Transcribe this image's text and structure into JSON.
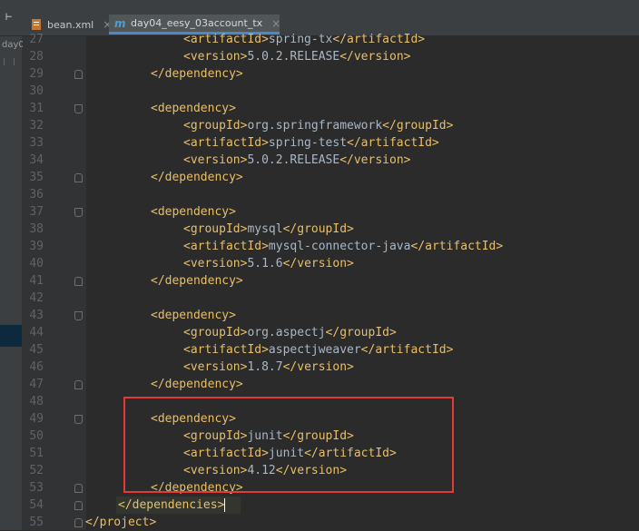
{
  "tabs": [
    {
      "label": "bean.xml",
      "icon": "xml-file-icon",
      "active": false
    },
    {
      "label": "day04_eesy_03account_tx",
      "icon": "maven-m-icon",
      "active": true
    }
  ],
  "sidebar": {
    "label": "day0"
  },
  "colors": {
    "tag": "#e8bf6a",
    "text": "#a9b7c6",
    "line_number": "#606366",
    "highlight_box": "#e53935"
  },
  "lines": [
    {
      "num": "27",
      "indent": 2,
      "open": "<artifactId>",
      "text": "spring-tx",
      "close": "</artifactId>"
    },
    {
      "num": "28",
      "indent": 2,
      "open": "<version>",
      "text": "5.0.2.RELEASE",
      "close": "</version>"
    },
    {
      "num": "29",
      "indent": 1,
      "open": "</dependency>",
      "text": "",
      "close": "",
      "fold": "close"
    },
    {
      "num": "30",
      "indent": 0,
      "open": "",
      "text": "",
      "close": ""
    },
    {
      "num": "31",
      "indent": 1,
      "open": "<dependency>",
      "text": "",
      "close": "",
      "fold": "open"
    },
    {
      "num": "32",
      "indent": 2,
      "open": "<groupId>",
      "text": "org.springframework",
      "close": "</groupId>"
    },
    {
      "num": "33",
      "indent": 2,
      "open": "<artifactId>",
      "text": "spring-test",
      "close": "</artifactId>"
    },
    {
      "num": "34",
      "indent": 2,
      "open": "<version>",
      "text": "5.0.2.RELEASE",
      "close": "</version>"
    },
    {
      "num": "35",
      "indent": 1,
      "open": "</dependency>",
      "text": "",
      "close": "",
      "fold": "close"
    },
    {
      "num": "36",
      "indent": 0,
      "open": "",
      "text": "",
      "close": ""
    },
    {
      "num": "37",
      "indent": 1,
      "open": "<dependency>",
      "text": "",
      "close": "",
      "fold": "open"
    },
    {
      "num": "38",
      "indent": 2,
      "open": "<groupId>",
      "text": "mysql",
      "close": "</groupId>"
    },
    {
      "num": "39",
      "indent": 2,
      "open": "<artifactId>",
      "text": "mysql-connector-java",
      "close": "</artifactId>"
    },
    {
      "num": "40",
      "indent": 2,
      "open": "<version>",
      "text": "5.1.6",
      "close": "</version>"
    },
    {
      "num": "41",
      "indent": 1,
      "open": "</dependency>",
      "text": "",
      "close": "",
      "fold": "close"
    },
    {
      "num": "42",
      "indent": 0,
      "open": "",
      "text": "",
      "close": ""
    },
    {
      "num": "43",
      "indent": 1,
      "open": "<dependency>",
      "text": "",
      "close": "",
      "fold": "open"
    },
    {
      "num": "44",
      "indent": 2,
      "open": "<groupId>",
      "text": "org.aspectj",
      "close": "</groupId>"
    },
    {
      "num": "45",
      "indent": 2,
      "open": "<artifactId>",
      "text": "aspectjweaver",
      "close": "</artifactId>"
    },
    {
      "num": "46",
      "indent": 2,
      "open": "<version>",
      "text": "1.8.7",
      "close": "</version>"
    },
    {
      "num": "47",
      "indent": 1,
      "open": "</dependency>",
      "text": "",
      "close": "",
      "fold": "close"
    },
    {
      "num": "48",
      "indent": 0,
      "open": "",
      "text": "",
      "close": ""
    },
    {
      "num": "49",
      "indent": 1,
      "open": "<dependency>",
      "text": "",
      "close": "",
      "fold": "open"
    },
    {
      "num": "50",
      "indent": 2,
      "open": "<groupId>",
      "text": "junit",
      "close": "</groupId>"
    },
    {
      "num": "51",
      "indent": 2,
      "open": "<artifactId>",
      "text": "junit",
      "close": "</artifactId>"
    },
    {
      "num": "52",
      "indent": 2,
      "open": "<version>",
      "text": "4.12",
      "close": "</version>"
    },
    {
      "num": "53",
      "indent": 1,
      "open": "</dependency>",
      "text": "",
      "close": "",
      "fold": "close"
    },
    {
      "num": "54",
      "indent": 0.5,
      "open": "</dependencies>",
      "text": "",
      "close": "",
      "fold": "close",
      "highlight": true
    },
    {
      "num": "55",
      "indent": 0,
      "open": "</project>",
      "text": "",
      "close": "",
      "fold": "close"
    }
  ]
}
